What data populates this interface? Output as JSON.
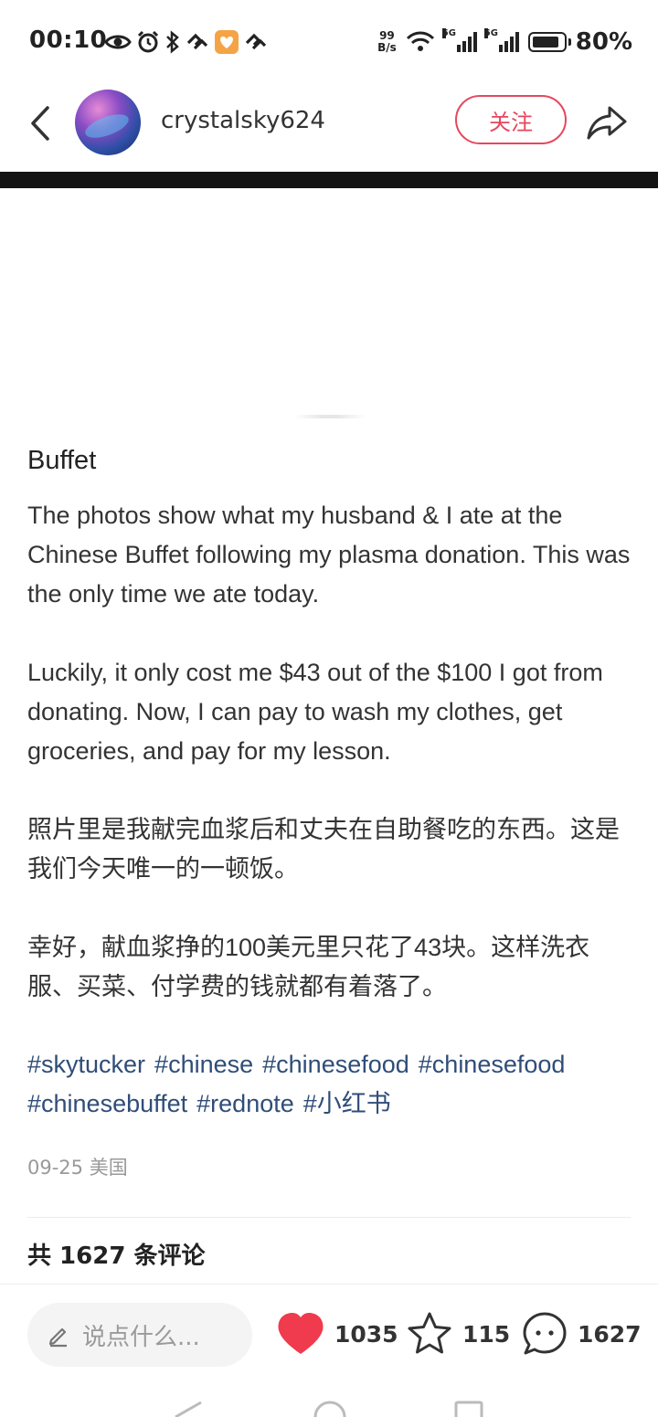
{
  "status_bar": {
    "time": "00:10",
    "net_speed_value": "99",
    "net_speed_unit": "B/s",
    "sim1_label": "5G",
    "sim2_label": "5G",
    "battery_percent": "80%",
    "battery_level": 0.8,
    "left_icons": [
      "eye-icon",
      "alarm-icon",
      "bluetooth-icon",
      "app-notification-icon",
      "heart-app-icon",
      "app-notification-icon"
    ]
  },
  "header": {
    "username": "crystalsky624",
    "follow_label": "关注"
  },
  "post": {
    "title": "Buffet",
    "paragraphs": [
      "The photos show what my husband & I ate at the Chinese Buffet following my plasma donation. This was the only time we ate today.",
      "Luckily, it only cost me $43 out of the $100 I got from donating. Now, I can pay to wash my clothes, get groceries, and pay for my lesson.",
      "照片里是我献完血浆后和丈夫在自助餐吃的东西。这是我们今天唯一的一顿饭。",
      "幸好，献血浆挣的100美元里只花了43块。这样洗衣服、买菜、付学费的钱就都有着落了。"
    ],
    "tags": [
      "#skytucker",
      "#chinese",
      "#chinesefood",
      "#chinesefood",
      "#chinesebuffet",
      "#rednote",
      "#小红书"
    ],
    "date": "09-25",
    "location": "美国"
  },
  "comments": {
    "header": "共 1627 条评论"
  },
  "bottom_bar": {
    "input_placeholder": "说点什么...",
    "likes": "1035",
    "favorites": "115",
    "comments": "1627",
    "like_color": "#f03a4d"
  }
}
